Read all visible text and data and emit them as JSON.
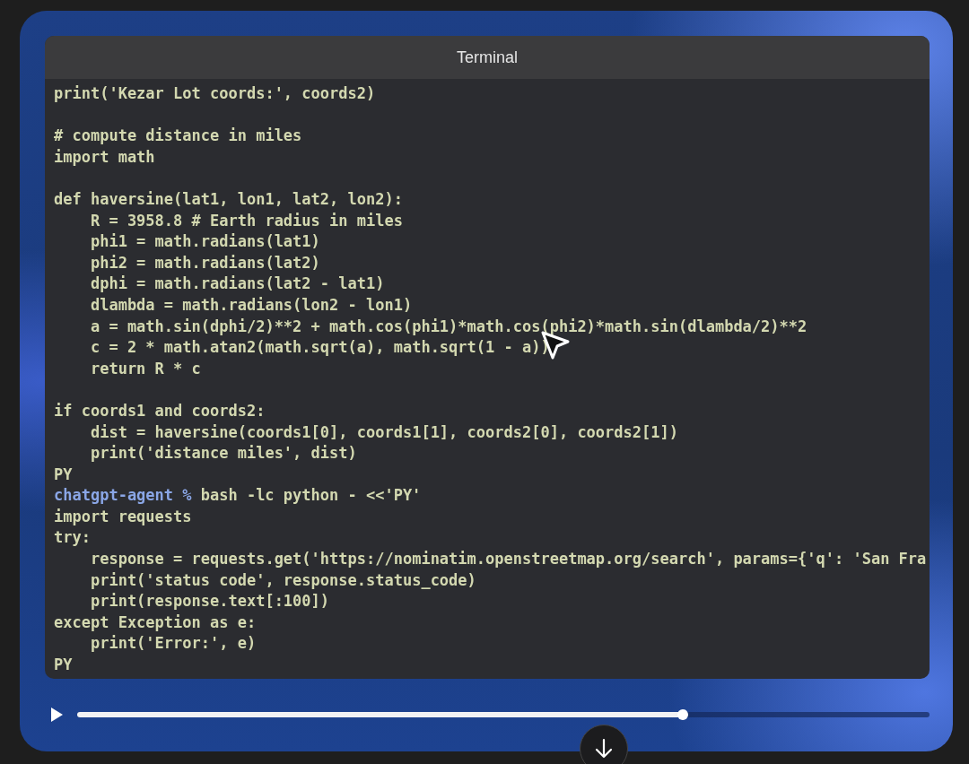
{
  "window": {
    "title": "Terminal"
  },
  "lines": [
    {
      "kind": "code",
      "text": "print('Kezar Lot coords:', coords2)"
    },
    {
      "kind": "blank"
    },
    {
      "kind": "code",
      "text": "# compute distance in miles"
    },
    {
      "kind": "code",
      "text": "import math"
    },
    {
      "kind": "blank"
    },
    {
      "kind": "code",
      "text": "def haversine(lat1, lon1, lat2, lon2):"
    },
    {
      "kind": "code",
      "text": "    R = 3958.8 # Earth radius in miles"
    },
    {
      "kind": "code",
      "text": "    phi1 = math.radians(lat1)"
    },
    {
      "kind": "code",
      "text": "    phi2 = math.radians(lat2)"
    },
    {
      "kind": "code",
      "text": "    dphi = math.radians(lat2 - lat1)"
    },
    {
      "kind": "code",
      "text": "    dlambda = math.radians(lon2 - lon1)"
    },
    {
      "kind": "code",
      "text": "    a = math.sin(dphi/2)**2 + math.cos(phi1)*math.cos(phi2)*math.sin(dlambda/2)**2"
    },
    {
      "kind": "code",
      "text": "    c = 2 * math.atan2(math.sqrt(a), math.sqrt(1 - a))"
    },
    {
      "kind": "code",
      "text": "    return R * c"
    },
    {
      "kind": "blank"
    },
    {
      "kind": "code",
      "text": "if coords1 and coords2:"
    },
    {
      "kind": "code",
      "text": "    dist = haversine(coords1[0], coords1[1], coords2[0], coords2[1])"
    },
    {
      "kind": "code",
      "text": "    print('distance miles', dist)"
    },
    {
      "kind": "code",
      "text": "PY"
    },
    {
      "kind": "prompt",
      "prompt": "chatgpt-agent %",
      "text": "bash -lc python - <<'PY'"
    },
    {
      "kind": "code",
      "text": "import requests"
    },
    {
      "kind": "code",
      "text": "try:"
    },
    {
      "kind": "code",
      "text": "    response = requests.get('https://nominatim.openstreetmap.org/search', params={'q': 'San Fra"
    },
    {
      "kind": "code",
      "text": "    print('status code', response.status_code)"
    },
    {
      "kind": "code",
      "text": "    print(response.text[:100])"
    },
    {
      "kind": "code",
      "text": "except Exception as e:"
    },
    {
      "kind": "code",
      "text": "    print('Error:', e)"
    },
    {
      "kind": "code",
      "text": "PY"
    }
  ],
  "progress": {
    "level": 0.71
  }
}
